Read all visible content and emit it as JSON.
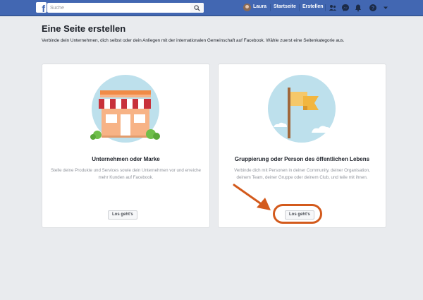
{
  "topbar": {
    "logo_letter": "f",
    "search_placeholder": "Suche",
    "user_name": "Laura",
    "nav_home": "Startseite",
    "nav_create": "Erstellen",
    "icons": [
      "friends-icon",
      "messenger-icon",
      "notifications-icon",
      "help-icon",
      "dropdown-caret-icon"
    ],
    "colors": {
      "bar": "#4267b2",
      "bar_border": "#29487d"
    }
  },
  "page": {
    "title": "Eine Seite erstellen",
    "subtitle": "Verbinde dein Unternehmen, dich selbst oder dein Anliegen mit der internationalen Gemeinschaft auf Facebook. Wähle zuerst eine Seitenkategorie aus."
  },
  "cards": [
    {
      "title": "Unternehmen oder Marke",
      "description": "Stelle deine Produkte und Services sowie dein Unternehmen vor und erreiche mehr Kunden auf Facebook.",
      "button": "Los geht's",
      "illustration": "storefront-icon"
    },
    {
      "title": "Gruppierung oder Person des öffentlichen Lebens",
      "description": "Verbinde dich mit Personen in deiner Community, deiner Organisation, deinem Team, deiner Gruppe oder deinem Club, und teile mit ihnen.",
      "button": "Los geht's",
      "illustration": "flag-icon"
    }
  ],
  "annotation": {
    "color": "#d35a1c",
    "target": "Los geht's"
  }
}
